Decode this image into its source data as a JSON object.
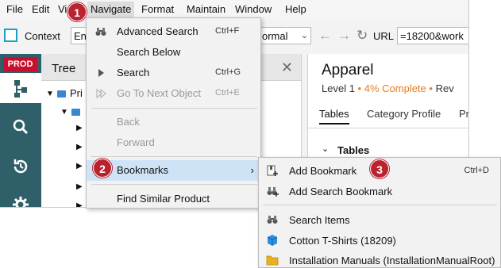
{
  "menubar": {
    "items": [
      "File",
      "Edit",
      "Vi",
      "Navigate",
      "Format",
      "Maintain",
      "Window",
      "Help"
    ]
  },
  "toolbar": {
    "context_label": "Context",
    "context_value": "En",
    "view_value": "ormal",
    "url_label": "URL",
    "url_value": "=18200&work"
  },
  "leftbar": {
    "env_badge": "PROD"
  },
  "tree": {
    "title": "Tree",
    "root_label": "Pri"
  },
  "product": {
    "title": "Apparel",
    "level": "Level 1",
    "complete": "4% Complete",
    "extra": "Rev",
    "tabs": [
      "Tables",
      "Category Profile",
      "Pr"
    ],
    "section": "Tables"
  },
  "navigate_menu": {
    "items": [
      {
        "label": "Advanced Search",
        "shortcut": "Ctrl+F",
        "icon": "binoculars-icon",
        "disabled": false
      },
      {
        "label": "Search Below",
        "shortcut": "",
        "icon": "",
        "disabled": false
      },
      {
        "label": "Search",
        "shortcut": "Ctrl+G",
        "icon": "play-icon",
        "disabled": false
      },
      {
        "label": "Go To Next Object",
        "shortcut": "Ctrl+E",
        "icon": "skip-icon",
        "disabled": true
      },
      {
        "label": "Back",
        "shortcut": "",
        "icon": "",
        "disabled": true
      },
      {
        "label": "Forward",
        "shortcut": "",
        "icon": "",
        "disabled": true
      },
      {
        "label": "Bookmarks",
        "shortcut": "",
        "icon": "",
        "disabled": false
      },
      {
        "label": "Find Similar Product",
        "shortcut": "",
        "icon": "",
        "disabled": false
      }
    ]
  },
  "bookmarks_submenu": {
    "items": [
      {
        "label": "Add Bookmark",
        "shortcut": "Ctrl+D",
        "icon": "bookmark-add-icon"
      },
      {
        "label": "Add Search Bookmark",
        "shortcut": "",
        "icon": "bookmark-search-icon"
      },
      {
        "label": "Search Items",
        "shortcut": "",
        "icon": "binoculars-icon"
      },
      {
        "label": "Cotton T-Shirts (18209)",
        "shortcut": "",
        "icon": "cube-icon"
      },
      {
        "label": "Installation Manuals (InstallationManualRoot)",
        "shortcut": "",
        "icon": "folder-icon"
      }
    ]
  },
  "callouts": [
    "1",
    "2",
    "3"
  ],
  "colors": {
    "accent_blue": "#1aa0c8",
    "prod_red": "#c8102e",
    "sidebar_teal": "#2f5f69",
    "callout_red": "#b8232f",
    "complete_orange": "#e87b1e",
    "highlight": "#cfe3f7"
  }
}
